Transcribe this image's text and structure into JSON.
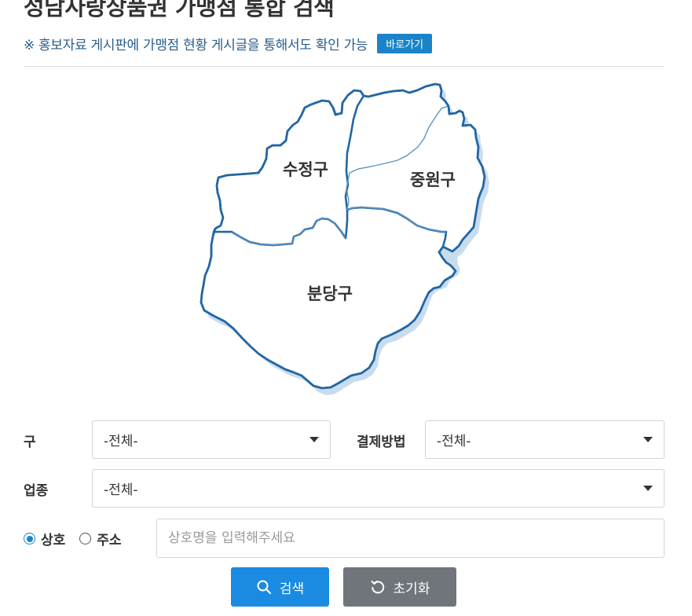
{
  "page": {
    "title": "성남사랑상품권 가맹점 통합 검색",
    "notice": "※ 홍보자료 게시판에 가맹점 현황 게시글을 통해서도 확인 가능",
    "go_button": "바로가기"
  },
  "map": {
    "districts": [
      {
        "id": "sujeong",
        "label": "수정구"
      },
      {
        "id": "jungwon",
        "label": "중원구"
      },
      {
        "id": "bundang",
        "label": "분당구"
      }
    ],
    "border_color": "#2367a3",
    "inner_border_color": "#5f92bf",
    "shadow_color": "#c9dcee"
  },
  "filters": {
    "gu": {
      "label": "구",
      "selected": "-전체-"
    },
    "payment": {
      "label": "결제방법",
      "selected": "-전체-"
    },
    "category": {
      "label": "업종",
      "selected": "-전체-"
    }
  },
  "search": {
    "radio_options": [
      {
        "label": "상호",
        "checked": true
      },
      {
        "label": "주소",
        "checked": false
      }
    ],
    "input_value": "",
    "input_placeholder": "상호명을 입력해주세요",
    "search_button": "검색",
    "reset_button": "초기화"
  },
  "colors": {
    "accent": "#1a84c8",
    "search_button": "#1a8be0",
    "reset_button": "#70757b"
  }
}
